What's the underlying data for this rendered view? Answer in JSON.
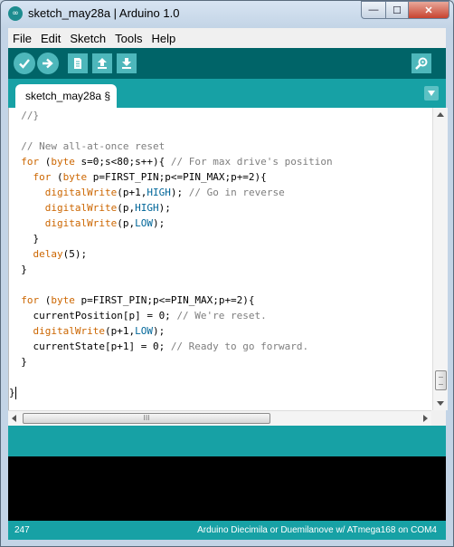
{
  "window": {
    "title": "sketch_may28a | Arduino 1.0",
    "app_icon": "arduino-logo-icon",
    "controls": {
      "minimize": "—",
      "maximize": "☐",
      "close": "✕"
    }
  },
  "menu": [
    "File",
    "Edit",
    "Sketch",
    "Tools",
    "Help"
  ],
  "toolbar": {
    "buttons": [
      "verify-icon",
      "upload-icon",
      "new-icon",
      "open-icon",
      "save-icon"
    ],
    "right": "serial-monitor-icon"
  },
  "tab": {
    "label": "sketch_may28a §"
  },
  "editor": {
    "lines": [
      [
        {
          "t": "  //}",
          "c": "cm"
        }
      ],
      [],
      [
        {
          "t": "  // New all-at-once reset",
          "c": "cm"
        }
      ],
      [
        {
          "t": "  ",
          "c": ""
        },
        {
          "t": "for",
          "c": "kw"
        },
        {
          "t": " (",
          "c": ""
        },
        {
          "t": "byte",
          "c": "kw"
        },
        {
          "t": " s=0;s<80;s++){ ",
          "c": ""
        },
        {
          "t": "// For max drive's position",
          "c": "cm"
        }
      ],
      [
        {
          "t": "    ",
          "c": ""
        },
        {
          "t": "for",
          "c": "kw"
        },
        {
          "t": " (",
          "c": ""
        },
        {
          "t": "byte",
          "c": "kw"
        },
        {
          "t": " p=FIRST_PIN;p<=PIN_MAX;p+=2){",
          "c": ""
        }
      ],
      [
        {
          "t": "      ",
          "c": ""
        },
        {
          "t": "digitalWrite",
          "c": "kw"
        },
        {
          "t": "(p+1,",
          "c": ""
        },
        {
          "t": "HIGH",
          "c": "kw2"
        },
        {
          "t": "); ",
          "c": ""
        },
        {
          "t": "// Go in reverse",
          "c": "cm"
        }
      ],
      [
        {
          "t": "      ",
          "c": ""
        },
        {
          "t": "digitalWrite",
          "c": "kw"
        },
        {
          "t": "(p,",
          "c": ""
        },
        {
          "t": "HIGH",
          "c": "kw2"
        },
        {
          "t": ");",
          "c": ""
        }
      ],
      [
        {
          "t": "      ",
          "c": ""
        },
        {
          "t": "digitalWrite",
          "c": "kw"
        },
        {
          "t": "(p,",
          "c": ""
        },
        {
          "t": "LOW",
          "c": "kw2"
        },
        {
          "t": ");",
          "c": ""
        }
      ],
      [
        {
          "t": "    }",
          "c": ""
        }
      ],
      [
        {
          "t": "    ",
          "c": ""
        },
        {
          "t": "delay",
          "c": "kw"
        },
        {
          "t": "(5);",
          "c": ""
        }
      ],
      [
        {
          "t": "  }",
          "c": ""
        }
      ],
      [],
      [
        {
          "t": "  ",
          "c": ""
        },
        {
          "t": "for",
          "c": "kw"
        },
        {
          "t": " (",
          "c": ""
        },
        {
          "t": "byte",
          "c": "kw"
        },
        {
          "t": " p=FIRST_PIN;p<=PIN_MAX;p+=2){",
          "c": ""
        }
      ],
      [
        {
          "t": "    currentPosition[p] = 0; ",
          "c": ""
        },
        {
          "t": "// We're reset.",
          "c": "cm"
        }
      ],
      [
        {
          "t": "    ",
          "c": ""
        },
        {
          "t": "digitalWrite",
          "c": "kw"
        },
        {
          "t": "(p+1,",
          "c": ""
        },
        {
          "t": "LOW",
          "c": "kw2"
        },
        {
          "t": ");",
          "c": ""
        }
      ],
      [
        {
          "t": "    currentState[p+1] = 0; ",
          "c": ""
        },
        {
          "t": "// Ready to go forward.",
          "c": "cm"
        }
      ],
      [
        {
          "t": "  }",
          "c": ""
        }
      ],
      [],
      [
        {
          "t": "}",
          "c": ""
        }
      ]
    ],
    "horizontal_scroll_grip": "III"
  },
  "status": {
    "line_number": "247",
    "board": "Arduino Diecimila or Duemilanove w/ ATmega168 on COM4"
  },
  "colors": {
    "toolbar": "#006468",
    "accent": "#17a1a5",
    "button": "#4db7bb",
    "keyword": "#cc6600",
    "constant": "#006699",
    "comment": "#7e7e7e"
  }
}
